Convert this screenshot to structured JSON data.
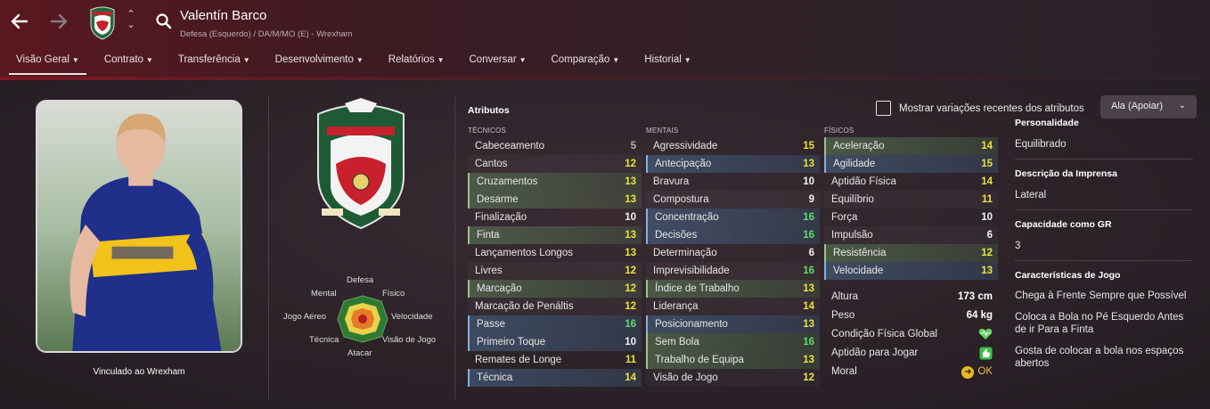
{
  "header": {
    "player_name": "Valentín Barco",
    "subtitle": "Defesa (Esquerdo) / DA/M/MO (E) - Wrexham",
    "tabs": [
      {
        "label": "Visão Geral",
        "active": true
      },
      {
        "label": "Contrato",
        "active": false
      },
      {
        "label": "Transferência",
        "active": false
      },
      {
        "label": "Desenvolvimento",
        "active": false
      },
      {
        "label": "Relatórios",
        "active": false
      },
      {
        "label": "Conversar",
        "active": false
      },
      {
        "label": "Comparação",
        "active": false
      },
      {
        "label": "Historial",
        "active": false
      }
    ]
  },
  "left": {
    "contract_label": "Vinculado ao Wrexham"
  },
  "radar": {
    "labels": {
      "top": "Defesa",
      "upper_left": "Mental",
      "upper_right": "Físico",
      "left": "Jogo Aéreo",
      "right": "Velocidade",
      "lower_left": "Técnica",
      "lower_right": "Visão de Jogo",
      "bottom": "Atacar"
    }
  },
  "attributes": {
    "title": "Atributos",
    "show_changes_label": "Mostrar variações recentes dos atributos",
    "role_select": "Ala (Apoiar)",
    "columns": {
      "tecnicos": {
        "header": "TÉCNICOS",
        "rows": [
          {
            "name": "Cabeceamento",
            "value": "5",
            "tone": "grey",
            "hl": ""
          },
          {
            "name": "Cantos",
            "value": "12",
            "tone": "yellow",
            "hl": ""
          },
          {
            "name": "Cruzamentos",
            "value": "13",
            "tone": "yellow",
            "hl": "green"
          },
          {
            "name": "Desarme",
            "value": "13",
            "tone": "yellow",
            "hl": "green"
          },
          {
            "name": "Finalização",
            "value": "10",
            "tone": "white",
            "hl": ""
          },
          {
            "name": "Finta",
            "value": "13",
            "tone": "yellow",
            "hl": "green"
          },
          {
            "name": "Lançamentos Longos",
            "value": "13",
            "tone": "yellow",
            "hl": ""
          },
          {
            "name": "Livres",
            "value": "12",
            "tone": "yellow",
            "hl": ""
          },
          {
            "name": "Marcação",
            "value": "12",
            "tone": "yellow",
            "hl": "green"
          },
          {
            "name": "Marcação de Penáltis",
            "value": "12",
            "tone": "yellow",
            "hl": ""
          },
          {
            "name": "Passe",
            "value": "16",
            "tone": "green",
            "hl": "blue"
          },
          {
            "name": "Primeiro Toque",
            "value": "10",
            "tone": "white",
            "hl": "blue"
          },
          {
            "name": "Remates de Longe",
            "value": "11",
            "tone": "yellow",
            "hl": ""
          },
          {
            "name": "Técnica",
            "value": "14",
            "tone": "yellow",
            "hl": "blue"
          }
        ]
      },
      "mentais": {
        "header": "MENTAIS",
        "rows": [
          {
            "name": "Agressividade",
            "value": "15",
            "tone": "yellow",
            "hl": ""
          },
          {
            "name": "Antecipação",
            "value": "13",
            "tone": "yellow",
            "hl": "blue"
          },
          {
            "name": "Bravura",
            "value": "10",
            "tone": "white",
            "hl": ""
          },
          {
            "name": "Compostura",
            "value": "9",
            "tone": "white",
            "hl": ""
          },
          {
            "name": "Concentração",
            "value": "16",
            "tone": "green",
            "hl": "blue"
          },
          {
            "name": "Decisões",
            "value": "16",
            "tone": "green",
            "hl": "blue"
          },
          {
            "name": "Determinação",
            "value": "6",
            "tone": "white",
            "hl": ""
          },
          {
            "name": "Imprevisibilidade",
            "value": "16",
            "tone": "green",
            "hl": ""
          },
          {
            "name": "Índice de Trabalho",
            "value": "13",
            "tone": "yellow",
            "hl": "green"
          },
          {
            "name": "Liderança",
            "value": "14",
            "tone": "yellow",
            "hl": ""
          },
          {
            "name": "Posicionamento",
            "value": "13",
            "tone": "yellow",
            "hl": "blue"
          },
          {
            "name": "Sem Bola",
            "value": "16",
            "tone": "green",
            "hl": "green"
          },
          {
            "name": "Trabalho de Equipa",
            "value": "13",
            "tone": "yellow",
            "hl": "green"
          },
          {
            "name": "Visão de Jogo",
            "value": "12",
            "tone": "yellow",
            "hl": ""
          }
        ]
      },
      "fisicos": {
        "header": "FÍSICOS",
        "rows": [
          {
            "name": "Aceleração",
            "value": "14",
            "tone": "yellow",
            "hl": "green"
          },
          {
            "name": "Agilidade",
            "value": "15",
            "tone": "yellow",
            "hl": "blue"
          },
          {
            "name": "Aptidão Física",
            "value": "14",
            "tone": "yellow",
            "hl": ""
          },
          {
            "name": "Equilíbrio",
            "value": "11",
            "tone": "yellow",
            "hl": ""
          },
          {
            "name": "Força",
            "value": "10",
            "tone": "white",
            "hl": ""
          },
          {
            "name": "Impulsão",
            "value": "6",
            "tone": "white",
            "hl": ""
          },
          {
            "name": "Resistência",
            "value": "12",
            "tone": "yellow",
            "hl": "green"
          },
          {
            "name": "Velocidade",
            "value": "13",
            "tone": "yellow",
            "hl": "blue"
          }
        ]
      }
    },
    "physical_info": {
      "height_label": "Altura",
      "height_value": "173 cm",
      "weight_label": "Peso",
      "weight_value": "64 kg",
      "condition_label": "Condição Física Global",
      "match_fitness_label": "Aptidão para Jogar",
      "morale_label": "Moral",
      "morale_value": "OK"
    }
  },
  "info": {
    "personality_head": "Personalidade",
    "personality_value": "Equilibrado",
    "media_head": "Descrição da Imprensa",
    "media_value": "Lateral",
    "gk_head": "Capacidade como GR",
    "gk_value": "3",
    "traits_head": "Características de Jogo",
    "traits": [
      "Chega à Frente Sempre que Possível",
      "Coloca a Bola no Pé Esquerdo Antes de ir Para a Finta",
      "Gosta de colocar a bola nos espaços abertos"
    ]
  },
  "colors": {
    "value_yellow": "#e9e23c",
    "value_green": "#5fdc6a",
    "highlight_green": "#9ac48a",
    "highlight_blue": "#7fb0e0",
    "header_red": "#5a1820"
  },
  "icons": [
    "back-arrow-icon",
    "forward-arrow-icon",
    "club-crest-icon",
    "chevron-up-down-icon",
    "search-icon",
    "chevron-down-icon",
    "heart-icon",
    "thumbs-up-icon",
    "morale-arrow-icon"
  ]
}
